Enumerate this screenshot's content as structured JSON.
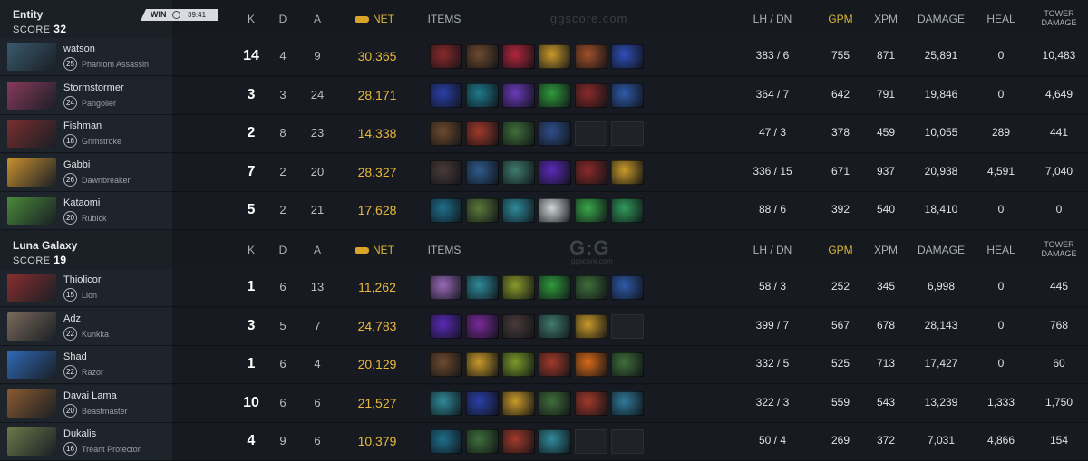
{
  "columns": {
    "k": "K",
    "d": "D",
    "a": "A",
    "net": "NET",
    "items": "ITEMS",
    "lhdn": "LH / DN",
    "gpm": "GPM",
    "xpm": "XPM",
    "damage": "DAMAGE",
    "heal": "HEAL",
    "tower1": "TOWER",
    "tower2": "DAMAGE"
  },
  "watermark_text": "ggscore.com",
  "logo_text": "G:G",
  "logo_sub": "ggscore.com",
  "teams": [
    {
      "name": "Entity",
      "score_label": "SCORE",
      "score": "32",
      "badge": {
        "result": "WIN",
        "time": "39:41"
      },
      "players": [
        {
          "name": "watson",
          "level": "25",
          "hero": "Phantom Assassin",
          "portrait": "#3a5a6e",
          "k": "14",
          "d": "4",
          "a": "9",
          "net": "30,365",
          "items": [
            "#8b2a2a",
            "#6e4a2e",
            "#b3263d",
            "#c99a2a",
            "#a2502a",
            "#2f4fb8"
          ],
          "lhdn": "383 / 6",
          "gpm": "755",
          "xpm": "871",
          "damage": "25,891",
          "heal": "0",
          "tower": "10,483"
        },
        {
          "name": "Stormstormer",
          "level": "24",
          "hero": "Pangolier",
          "portrait": "#8a3a5c",
          "k": "3",
          "d": "3",
          "a": "24",
          "net": "28,171",
          "items": [
            "#2b3fa8",
            "#1f7a8c",
            "#6a3ab8",
            "#2f9a3a",
            "#8b2a2a",
            "#2f5aa8"
          ],
          "lhdn": "364 / 7",
          "gpm": "642",
          "xpm": "791",
          "damage": "19,846",
          "heal": "0",
          "tower": "4,649"
        },
        {
          "name": "Fishman",
          "level": "18",
          "hero": "Grimstroke",
          "portrait": "#7a2e2e",
          "k": "2",
          "d": "8",
          "a": "23",
          "net": "14,338",
          "items": [
            "#6e4a2e",
            "#a23a2a",
            "#3f6e3a",
            "#2f4f8a",
            "empty",
            "empty"
          ],
          "lhdn": "47 / 3",
          "gpm": "378",
          "xpm": "459",
          "damage": "10,055",
          "heal": "289",
          "tower": "441"
        },
        {
          "name": "Gabbi",
          "level": "26",
          "hero": "Dawnbreaker",
          "portrait": "#c9902e",
          "k": "7",
          "d": "2",
          "a": "20",
          "net": "28,327",
          "items": [
            "#4a3a3a",
            "#2f5a8a",
            "#3f7a6e",
            "#5a2ab8",
            "#8b2a2a",
            "#c99a2a"
          ],
          "lhdn": "336 / 15",
          "gpm": "671",
          "xpm": "937",
          "damage": "20,938",
          "heal": "4,591",
          "tower": "7,040"
        },
        {
          "name": "Kataomi",
          "level": "20",
          "hero": "Rubick",
          "portrait": "#4a8a3a",
          "k": "5",
          "d": "2",
          "a": "21",
          "net": "17,628",
          "items": [
            "#1f6e8c",
            "#5a7a3a",
            "#2f8a9a",
            "#cfd6d8",
            "#3aa84a",
            "#2f9a5a"
          ],
          "lhdn": "88 / 6",
          "gpm": "392",
          "xpm": "540",
          "damage": "18,410",
          "heal": "0",
          "tower": "0"
        }
      ]
    },
    {
      "name": "Luna Galaxy",
      "score_label": "SCORE",
      "score": "19",
      "players": [
        {
          "name": "Thiolicor",
          "level": "15",
          "hero": "Lion",
          "portrait": "#8a2e2e",
          "k": "1",
          "d": "6",
          "a": "13",
          "net": "11,262",
          "items": [
            "#9a6ab8",
            "#2f8a9a",
            "#8a9a2a",
            "#2f9a3a",
            "#3f6e3a",
            "#2f5aa8"
          ],
          "lhdn": "58 / 3",
          "gpm": "252",
          "xpm": "345",
          "damage": "6,998",
          "heal": "0",
          "tower": "445"
        },
        {
          "name": "Adz",
          "level": "22",
          "hero": "Kunkka",
          "portrait": "#7a6a5a",
          "k": "3",
          "d": "5",
          "a": "7",
          "net": "24,783",
          "items": [
            "#5a2ab8",
            "#7a2a9a",
            "#4a3a3a",
            "#3f7a6e",
            "#c99a2a",
            "empty"
          ],
          "lhdn": "399 / 7",
          "gpm": "567",
          "xpm": "678",
          "damage": "28,143",
          "heal": "0",
          "tower": "768"
        },
        {
          "name": "Shad",
          "level": "22",
          "hero": "Razor",
          "portrait": "#2f6ab8",
          "k": "1",
          "d": "6",
          "a": "4",
          "net": "20,129",
          "items": [
            "#6e4a2e",
            "#c99a2a",
            "#7a9a2a",
            "#a23a2a",
            "#d86a1a",
            "#3f6e3a"
          ],
          "lhdn": "332 / 5",
          "gpm": "525",
          "xpm": "713",
          "damage": "17,427",
          "heal": "0",
          "tower": "60"
        },
        {
          "name": "Davai Lama",
          "level": "20",
          "hero": "Beastmaster",
          "portrait": "#8a5a2e",
          "k": "10",
          "d": "6",
          "a": "6",
          "net": "21,527",
          "items": [
            "#2f8a9a",
            "#2b3fa8",
            "#c99a2a",
            "#3f6e3a",
            "#a23a2a",
            "#2f7a9a"
          ],
          "lhdn": "322 / 3",
          "gpm": "559",
          "xpm": "543",
          "damage": "13,239",
          "heal": "1,333",
          "tower": "1,750"
        },
        {
          "name": "Dukalis",
          "level": "16",
          "hero": "Treant Protector",
          "portrait": "#6a7a4a",
          "k": "4",
          "d": "9",
          "a": "6",
          "net": "10,379",
          "items": [
            "#1f6e8c",
            "#3f6e3a",
            "#a23a2a",
            "#2f8a9a",
            "empty",
            "empty"
          ],
          "lhdn": "50 / 4",
          "gpm": "269",
          "xpm": "372",
          "damage": "7,031",
          "heal": "4,866",
          "tower": "154"
        }
      ]
    }
  ]
}
